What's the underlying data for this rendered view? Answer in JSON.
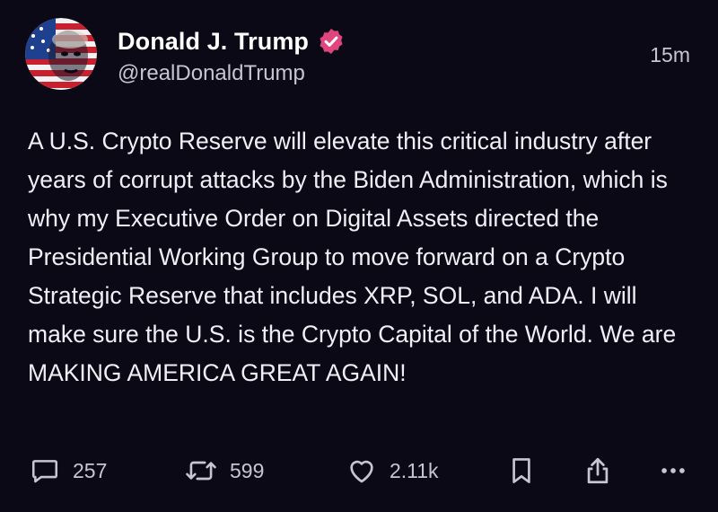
{
  "author": {
    "display_name": "Donald J. Trump",
    "handle": "@realDonaldTrump",
    "avatar_icon": "avatar-flag-portrait",
    "verified_icon": "verified-badge-icon",
    "verified_color": "#e0457d"
  },
  "post": {
    "timestamp": "15m",
    "text": "A U.S. Crypto Reserve will elevate this critical industry after years of corrupt attacks by the Biden Administration, which is why my Executive Order on Digital Assets directed the Presidential Working Group to move forward on a Crypto Strategic Reserve that includes XRP, SOL, and ADA. I will make sure the U.S. is the Crypto Capital of the World. We are MAKING AMERICA GREAT AGAIN!"
  },
  "actions": {
    "reply": {
      "icon": "speech-bubble-icon",
      "count": "257"
    },
    "repost": {
      "icon": "repost-arrows-icon",
      "count": "599"
    },
    "like": {
      "icon": "heart-icon",
      "count": "2.11k"
    },
    "bookmark": {
      "icon": "bookmark-icon"
    },
    "share": {
      "icon": "share-icon"
    },
    "more": {
      "icon": "ellipsis-icon"
    }
  },
  "colors": {
    "background": "#0c0917",
    "text": "#f1eff5",
    "secondary": "#c9c4d4"
  }
}
